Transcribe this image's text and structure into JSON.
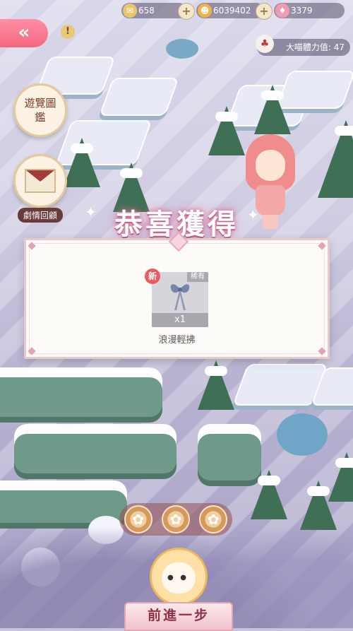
{
  "resources": [
    {
      "icon": "gift-ticket-icon",
      "value": "658"
    },
    {
      "icon": "cat-coin-icon",
      "value": "6039402"
    },
    {
      "icon": "diamond-icon",
      "value": "3379"
    }
  ],
  "plus_label": "+",
  "back_label": "«",
  "warning_label": "!",
  "stamina": {
    "label": "大喵體力值: 47"
  },
  "side_buttons": {
    "gallery": {
      "label": "遊覽圖鑑"
    },
    "story": {
      "label": "劇情回顧"
    }
  },
  "reward": {
    "title": "恭喜獲得",
    "item": {
      "name": "浪漫輕拂",
      "quantity": "x1",
      "rarity": "稀有",
      "new_badge": "新"
    }
  },
  "dice": [
    "✿",
    "✿",
    "✿"
  ],
  "forward_button": "前進一步",
  "colors": {
    "accent_pink": "#f4667f",
    "panel_border": "#e9c8cb",
    "title_glow": "#d26a92"
  }
}
